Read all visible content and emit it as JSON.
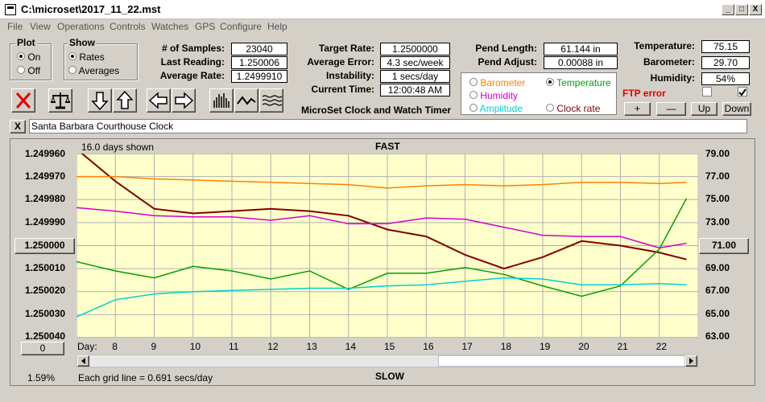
{
  "window": {
    "title": "C:\\microset\\2017_11_22.mst",
    "min": "_",
    "max": "□",
    "close": "X"
  },
  "menu": [
    "File",
    "View",
    "Operations",
    "Controls",
    "Watches",
    "GPS",
    "Configure",
    "Help"
  ],
  "plot_group": {
    "title": "Plot",
    "on": "On",
    "off": "Off",
    "selected": "On"
  },
  "show_group": {
    "title": "Show",
    "rates": "Rates",
    "averages": "Averages",
    "selected": "Rates"
  },
  "stats1": {
    "samples_label": "# of Samples:",
    "samples": "23040",
    "last_label": "Last Reading:",
    "last": "1.250006",
    "avg_label": "Average Rate:",
    "avg": "1.2499910"
  },
  "stats2": {
    "target_label": "Target Rate:",
    "target": "1.2500000",
    "avgerr_label": "Average Error:",
    "avgerr": "4.3 sec/week",
    "instab_label": "Instability:",
    "instab": "1 secs/day",
    "time_label": "Current Time:",
    "time": "12:00:48 AM"
  },
  "app_caption": "MicroSet Clock and Watch Timer",
  "pendulum": {
    "length_label": "Pend Length:",
    "length": "61.144 in",
    "adjust_label": "Pend Adjust:",
    "adjust": "0.00088 in"
  },
  "sensors": {
    "temp_label": "Temperature:",
    "temp": "75.15",
    "baro_label": "Barometer:",
    "baro": "29.70",
    "hum_label": "Humidity:",
    "hum": "54%"
  },
  "overlay": {
    "barometer": "Barometer",
    "temperature": "Temperature",
    "humidity": "Humidity",
    "amplitude": "Amplitude",
    "clock_rate": "Clock rate",
    "selected": "Temperature",
    "colors": {
      "barometer": "#ff8000",
      "temperature": "#00a000",
      "humidity": "#d000d0",
      "amplitude": "#00d0d0",
      "clock_rate": "#800000"
    }
  },
  "ftp": {
    "label": "FTP error"
  },
  "small_buttons": {
    "plus": "+",
    "minus": "—",
    "up": "Up",
    "down": "Down"
  },
  "clock_name": "Santa Barbara Courthouse Clock",
  "clock_close": "X",
  "plot": {
    "days_shown": "16.0 days shown",
    "fast": "FAST",
    "slow": "SLOW",
    "left_ticks": [
      "1.249960",
      "1.249970",
      "1.249980",
      "1.249990",
      "1.250000",
      "1.250010",
      "1.250020",
      "1.250030",
      "1.250040"
    ],
    "right_ticks": [
      "79.00",
      "77.00",
      "75.00",
      "73.00",
      "71.00",
      "69.00",
      "67.00",
      "65.00",
      "63.00"
    ],
    "day_label": "Day:",
    "days": [
      "8",
      "9",
      "10",
      "11",
      "12",
      "13",
      "14",
      "15",
      "16",
      "17",
      "18",
      "19",
      "20",
      "21",
      "22"
    ],
    "left_zero_button": "0",
    "center_left_button": "1.250000",
    "center_right_button": "71.00",
    "percent": "1.59%",
    "grid_note": "Each grid line = 0.691 secs/day"
  },
  "chart_data": {
    "type": "line",
    "x": [
      7.0,
      8.0,
      9.0,
      10.0,
      11.0,
      12.0,
      13.0,
      14.0,
      15.0,
      16.0,
      17.0,
      18.0,
      19.0,
      20.0,
      21.0,
      22.0,
      22.7
    ],
    "series": [
      {
        "name": "Clock rate",
        "color": "#800000",
        "values": [
          1.249958,
          1.249972,
          1.249984,
          1.249986,
          1.249985,
          1.249984,
          1.249985,
          1.249987,
          1.249993,
          1.249996,
          1.250004,
          1.25001,
          1.250005,
          1.249998,
          1.25,
          1.250003,
          1.250006
        ]
      },
      {
        "name": "Barometer",
        "color": "#ff8000",
        "values": [
          77.0,
          77.0,
          76.8,
          76.7,
          76.6,
          76.5,
          76.4,
          76.3,
          76.0,
          76.2,
          76.3,
          76.2,
          76.3,
          76.5,
          76.5,
          76.4,
          76.5
        ]
      },
      {
        "name": "Humidity",
        "color": "#d000d0",
        "values": [
          74.3,
          74.0,
          73.6,
          73.5,
          73.5,
          73.2,
          73.6,
          72.9,
          72.9,
          73.4,
          73.3,
          72.6,
          71.9,
          71.8,
          71.8,
          70.8,
          71.2
        ]
      },
      {
        "name": "Temperature",
        "color": "#00a000",
        "values": [
          69.6,
          68.8,
          68.2,
          69.2,
          68.8,
          68.1,
          68.8,
          67.2,
          68.6,
          68.6,
          69.1,
          68.5,
          67.5,
          66.6,
          67.5,
          70.7,
          75.1
        ]
      },
      {
        "name": "Amplitude",
        "color": "#00d0d0",
        "values": [
          64.8,
          66.3,
          66.8,
          67.0,
          67.1,
          67.2,
          67.3,
          67.3,
          67.5,
          67.6,
          67.9,
          68.2,
          68.1,
          67.6,
          67.6,
          67.7,
          67.6
        ]
      }
    ],
    "ylim_left": [
      1.24996,
      1.25004
    ],
    "ylim_right": [
      63.0,
      79.0
    ],
    "xlim": [
      7.0,
      23.0
    ],
    "grid": true
  }
}
